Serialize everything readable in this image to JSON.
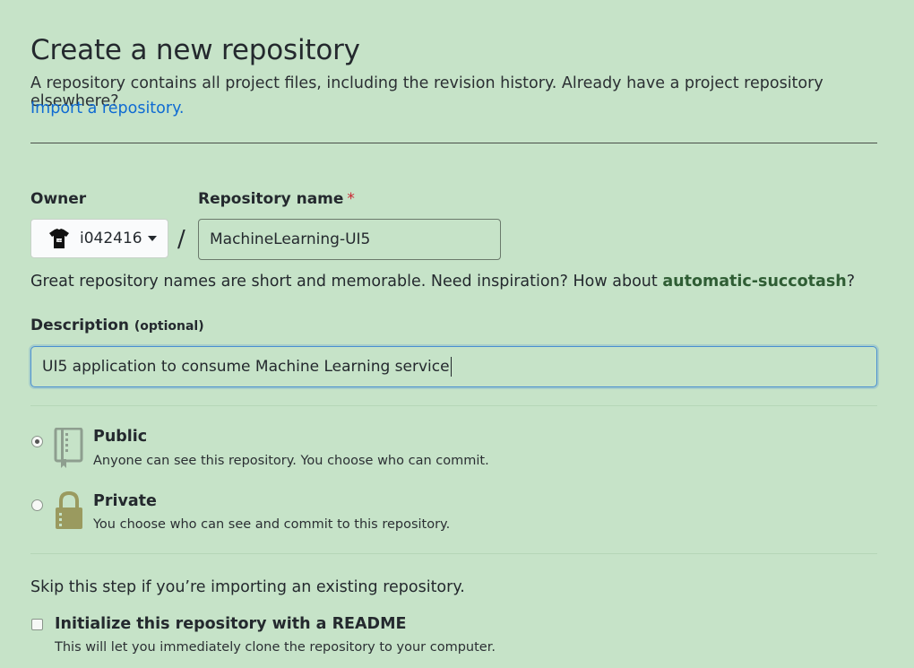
{
  "header": {
    "title": "Create a new repository",
    "lead": "A repository contains all project files, including the revision history. Already have a project repository elsewhere?",
    "import_link": "Import a repository."
  },
  "owner": {
    "label": "Owner",
    "login": "i042416",
    "avatar_icon": "tshirt-avatar-icon"
  },
  "repo_name": {
    "label": "Repository name",
    "required_mark": "*",
    "value": "MachineLearning-UI5",
    "separator": "/"
  },
  "hint": {
    "text": "Great repository names are short and memorable. Need inspiration? How about",
    "suggestion": "automatic-succotash",
    "trailing": "?"
  },
  "description": {
    "label": "Description",
    "optional": "(optional)",
    "value": "UI5 application to consume Machine Learning service"
  },
  "visibility": {
    "selected": "public",
    "options": [
      {
        "id": "public",
        "title": "Public",
        "desc": "Anyone can see this repository. You choose who can commit.",
        "icon": "repo-book-icon"
      },
      {
        "id": "private",
        "title": "Private",
        "desc": "You choose who can see and commit to this repository.",
        "icon": "lock-icon"
      }
    ]
  },
  "init": {
    "skip_text": "Skip this step if you’re importing an existing repository.",
    "readme_title": "Initialize this repository with a README",
    "readme_desc": "This will let you immediately clone the repository to your computer."
  },
  "colors": {
    "background": "#c6e3c8",
    "link": "#0f6bd3",
    "suggestion": "#2f5d34",
    "required": "#cb2431",
    "focus": "#4a8fd1"
  }
}
